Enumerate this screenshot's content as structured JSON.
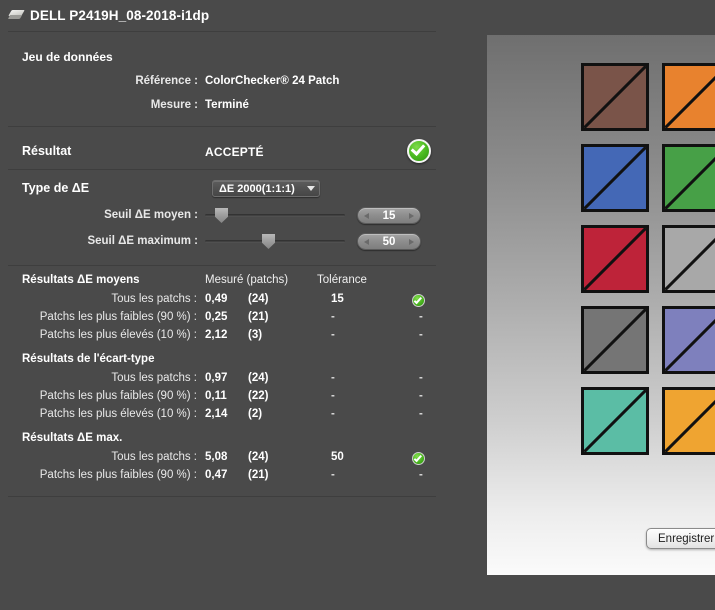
{
  "window": {
    "title": "DELL P2419H_08-2018-i1dp",
    "icon": "display-slab-icon"
  },
  "dataset": {
    "heading": "Jeu de données",
    "reference_label": "Référence :",
    "reference_value": "ColorChecker® 24 Patch",
    "measure_label": "Mesure :",
    "measure_value": "Terminé"
  },
  "result": {
    "label": "Résultat",
    "value": "ACCEPTÉ",
    "badge_icon": "green-check-circle-icon",
    "badge_color": "#4cbb22"
  },
  "delta_e": {
    "type_label": "Type de ΔE",
    "type_selected": "ΔE 2000(1:1:1)",
    "type_options": [
      "ΔE 2000(1:1:1)"
    ],
    "mean_threshold_label": "Seuil ΔE moyen :",
    "mean_threshold_value": "15",
    "mean_slider_percent": 13,
    "max_threshold_label": "Seuil ΔE maximum :",
    "max_threshold_value": "50",
    "max_slider_percent": 45
  },
  "results": {
    "columns": {
      "measured": "Mesuré (patchs)",
      "tolerance": "Tolérance"
    },
    "groups": [
      {
        "title": "Résultats ΔE moyens",
        "rows": [
          {
            "label": "Tous les patchs :",
            "measured": "0,49",
            "patches": "(24)",
            "tolerance": "15",
            "status": "ok"
          },
          {
            "label": "Patchs les plus faibles (90 %) :",
            "measured": "0,25",
            "patches": "(21)",
            "tolerance": "-",
            "status": "-"
          },
          {
            "label": "Patchs les plus élevés (10 %) :",
            "measured": "2,12",
            "patches": "(3)",
            "tolerance": "-",
            "status": "-"
          }
        ]
      },
      {
        "title": "Résultats de l'écart-type",
        "rows": [
          {
            "label": "Tous les patchs :",
            "measured": "0,97",
            "patches": "(24)",
            "tolerance": "-",
            "status": "-"
          },
          {
            "label": "Patchs les plus faibles (90 %) :",
            "measured": "0,11",
            "patches": "(22)",
            "tolerance": "-",
            "status": "-"
          },
          {
            "label": "Patchs les plus élevés (10 %) :",
            "measured": "2,14",
            "patches": "(2)",
            "tolerance": "-",
            "status": "-"
          }
        ]
      },
      {
        "title": "Résultats ΔE max.",
        "rows": [
          {
            "label": "Tous les patchs :",
            "measured": "5,08",
            "patches": "(24)",
            "tolerance": "50",
            "status": "ok"
          },
          {
            "label": "Patchs les plus faibles (90 %) :",
            "measured": "0,47",
            "patches": "(21)",
            "tolerance": "-",
            "status": "-"
          }
        ]
      }
    ]
  },
  "patch_preview": {
    "patches": [
      {
        "name": "patch-brown",
        "color": "#7a5449"
      },
      {
        "name": "patch-orange",
        "color": "#e8822e"
      },
      {
        "name": "patch-blue",
        "color": "#4468b6"
      },
      {
        "name": "patch-green",
        "color": "#47a047"
      },
      {
        "name": "patch-crimson",
        "color": "#be2339"
      },
      {
        "name": "patch-light-gray",
        "color": "#a8a8a8"
      },
      {
        "name": "patch-mid-gray",
        "color": "#757575"
      },
      {
        "name": "patch-purple",
        "color": "#7e80bd"
      },
      {
        "name": "patch-teal",
        "color": "#5bbda5"
      },
      {
        "name": "patch-amber",
        "color": "#efa431"
      }
    ]
  },
  "footer": {
    "save_label": "Enregistrer"
  }
}
